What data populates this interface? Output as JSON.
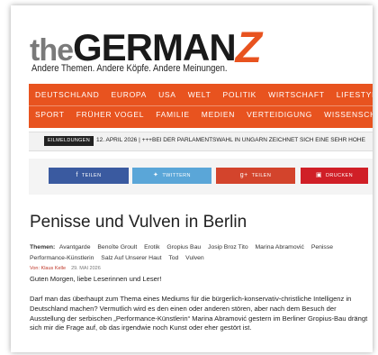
{
  "site": {
    "logo_the": "the",
    "logo_german": "GERMAN",
    "logo_z": "Z",
    "tagline": "Andere Themen. Andere Köpfe. Andere Meinungen."
  },
  "nav": {
    "row1": [
      "DEUTSCHLAND",
      "EUROPA",
      "USA",
      "WELT",
      "POLITIK",
      "WIRTSCHAFT",
      "LIFESTYLE"
    ],
    "row2": [
      "SPORT",
      "FRÜHER VOGEL",
      "FAMILIE",
      "MEDIEN",
      "VERTEIDIGUNG",
      "WISSENSCHAFT"
    ]
  },
  "ticker": {
    "badge": "EILMELDUNGEN",
    "text": "12. APRIL 2026 | +++BEI DER PARLAMENTSWAHL IN UNGARN ZEICHNET SICH EINE SEHR HOHE"
  },
  "share": {
    "facebook": "TEILEN",
    "twitter": "TWITTERN",
    "google": "TEILEN",
    "print": "DRUCKEN"
  },
  "article": {
    "title": "Penisse und Vulven in Berlin",
    "tags_label": "Themen:",
    "tags": [
      "Avantgarde",
      "Benoîte Groult",
      "Erotik",
      "Gropius Bau",
      "Josip Broz Tito",
      "Marina Abramović",
      "Penisse",
      "Performance-Künstlerin",
      "Salz Auf Unserer Haut",
      "Tod",
      "Vulven"
    ],
    "author": "Von: Klaus Kelle",
    "date": "29. MAI 2026",
    "greeting": "Guten Morgen, liebe Leserinnen und Leser!",
    "paragraph": "Darf man das überhaupt zum Thema eines Mediums für die bürgerlich-konservativ-christliche Intelligenz in Deutschland machen? Vermutlich wird es den einen oder anderen stören, aber nach dem Besuch der Ausstellung der serbischen „Performance-Künstlerin“ Marina Abramović gestern im Berliner Gropius-Bau drängt sich mir die Frage auf, ob das irgendwie noch Kunst oder eher gestört ist."
  },
  "colors": {
    "accent": "#e8531f",
    "facebook": "#3a5aa0",
    "twitter": "#5aa6d8",
    "google": "#d3442c",
    "print": "#d01f27"
  }
}
